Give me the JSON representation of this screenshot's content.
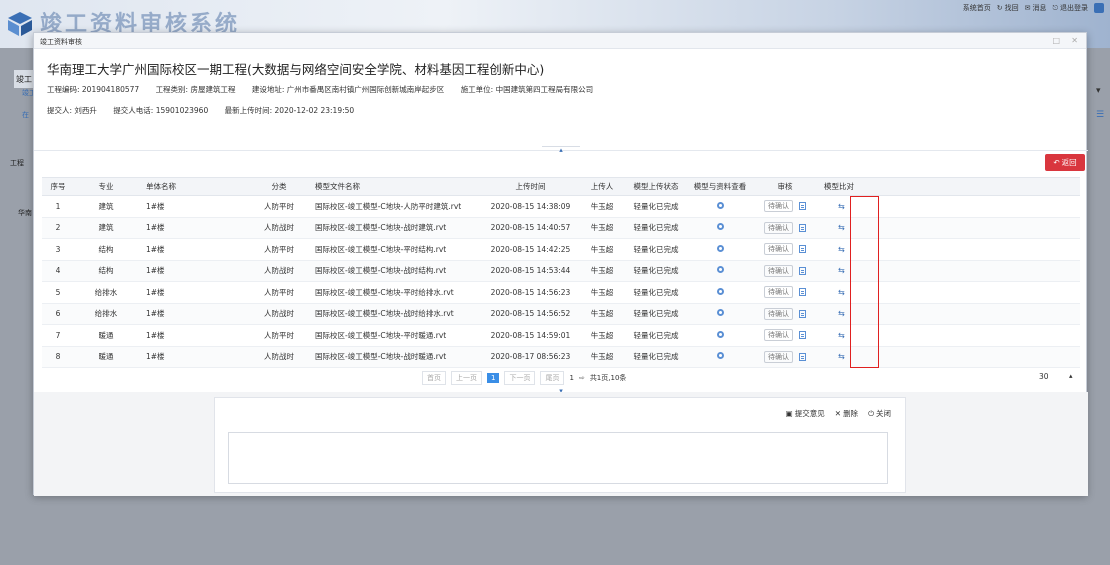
{
  "app": {
    "title": "竣工资料审核系统",
    "top_links": [
      "系统首页",
      "找回",
      "消息",
      "退出登录"
    ],
    "bg_tab": "竣工",
    "bg_side_a": "工程",
    "bg_side_b": "华南",
    "bg_link_a": "竣工",
    "bg_link_b": "在",
    "bg_right_a": "▾",
    "bg_right_b": "☰"
  },
  "modal": {
    "title": "竣工资料审核",
    "max_icon": "□",
    "close_icon": "✕",
    "project_name": "华南理工大学广州国际校区一期工程(大数据与网络空间安全学院、材料基因工程创新中心)",
    "info_row1": [
      "工程编码: 201904180577",
      "工程类别: 房屋建筑工程",
      "建设地址: 广州市番禺区南村镇广州国际创新城南岸起步区",
      "施工单位: 中国建筑第四工程局有限公司"
    ],
    "info_row2": [
      "提交人: 刘西升",
      "提交人电话: 15901023960",
      "最新上传时间: 2020-12-02 23:19:50"
    ],
    "back_label": "返回"
  },
  "table": {
    "headers": [
      "序号",
      "专业",
      "单体名称",
      "分类",
      "模型文件名称",
      "上传时间",
      "上传人",
      "模型上传状态",
      "模型与资料查看",
      "审核",
      "模型比对"
    ],
    "confirm_label": "待确认",
    "rows": [
      [
        "1",
        "建筑",
        "1#楼",
        "人防平时",
        "国际校区-竣工模型-C地块-人防平时建筑.rvt",
        "2020-08-15 14:38:09",
        "牛玉超",
        "轻量化已完成"
      ],
      [
        "2",
        "建筑",
        "1#楼",
        "人防战时",
        "国际校区-竣工模型-C地块-战时建筑.rvt",
        "2020-08-15 14:40:57",
        "牛玉超",
        "轻量化已完成"
      ],
      [
        "3",
        "结构",
        "1#楼",
        "人防平时",
        "国际校区-竣工模型-C地块-平时结构.rvt",
        "2020-08-15 14:42:25",
        "牛玉超",
        "轻量化已完成"
      ],
      [
        "4",
        "结构",
        "1#楼",
        "人防战时",
        "国际校区-竣工模型-C地块-战时结构.rvt",
        "2020-08-15 14:53:44",
        "牛玉超",
        "轻量化已完成"
      ],
      [
        "5",
        "给排水",
        "1#楼",
        "人防平时",
        "国际校区-竣工模型-C地块-平时给排水.rvt",
        "2020-08-15 14:56:23",
        "牛玉超",
        "轻量化已完成"
      ],
      [
        "6",
        "给排水",
        "1#楼",
        "人防战时",
        "国际校区-竣工模型-C地块-战时给排水.rvt",
        "2020-08-15 14:56:52",
        "牛玉超",
        "轻量化已完成"
      ],
      [
        "7",
        "暖通",
        "1#楼",
        "人防平时",
        "国际校区-竣工模型-C地块-平时暖通.rvt",
        "2020-08-15 14:59:01",
        "牛玉超",
        "轻量化已完成"
      ],
      [
        "8",
        "暖通",
        "1#楼",
        "人防战时",
        "国际校区-竣工模型-C地块-战时暖通.rvt",
        "2020-08-17 08:56:23",
        "牛玉超",
        "轻量化已完成"
      ]
    ]
  },
  "pager": {
    "first": "首页",
    "prev": "上一页",
    "current": "1",
    "next": "下一页",
    "last": "尾页",
    "goto_value": "1",
    "total": "共1页,10条",
    "page_size": "30"
  },
  "opinion": {
    "submit_label": "提交意见",
    "delete_label": "删除",
    "close_label": "关闭"
  },
  "colors": {
    "accent": "#3a8ee6",
    "danger": "#d9363e",
    "highlight": "#e02020"
  }
}
